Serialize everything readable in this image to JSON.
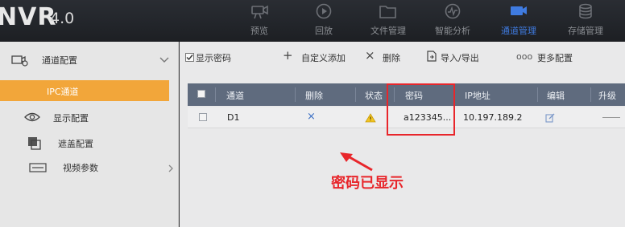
{
  "brand": {
    "name": "NVR",
    "version": "4.0"
  },
  "top_nav": [
    {
      "label": "预览",
      "icon": "camera-icon"
    },
    {
      "label": "回放",
      "icon": "playback-icon"
    },
    {
      "label": "文件管理",
      "icon": "folder-icon"
    },
    {
      "label": "智能分析",
      "icon": "analysis-icon"
    },
    {
      "label": "通道管理",
      "icon": "camera-channel-icon",
      "active": true
    },
    {
      "label": "存储管理",
      "icon": "database-icon"
    }
  ],
  "sidebar": {
    "section_label": "通道配置",
    "selected_sub": "IPC通道",
    "items": [
      {
        "label": "显示配置",
        "icon": "eye-icon"
      },
      {
        "label": "遮盖配置",
        "icon": "mask-icon"
      },
      {
        "label": "视频参数",
        "icon": "video-icon"
      }
    ]
  },
  "toolbar": {
    "show_password_label": "显示密码",
    "show_password_checked": true,
    "add_label": "自定义添加",
    "delete_label": "删除",
    "import_export_label": "导入/导出",
    "more_label": "更多配置",
    "more_prefix": "ooo"
  },
  "grid": {
    "columns": [
      "通道",
      "删除",
      "状态",
      "密码",
      "IP地址",
      "编辑",
      "升级"
    ],
    "rows": [
      {
        "channel": "D1",
        "delete": "×",
        "password": "a123345...",
        "ip": "10.197.189.2"
      }
    ]
  },
  "annotation": {
    "text": "密码已显示",
    "color": "#e8262b"
  },
  "colors": {
    "accent_active": "#3f7be0",
    "sidebar_selected": "#f2a63a",
    "grid_header": "#5f6b7e",
    "warning": "#f3c623"
  }
}
